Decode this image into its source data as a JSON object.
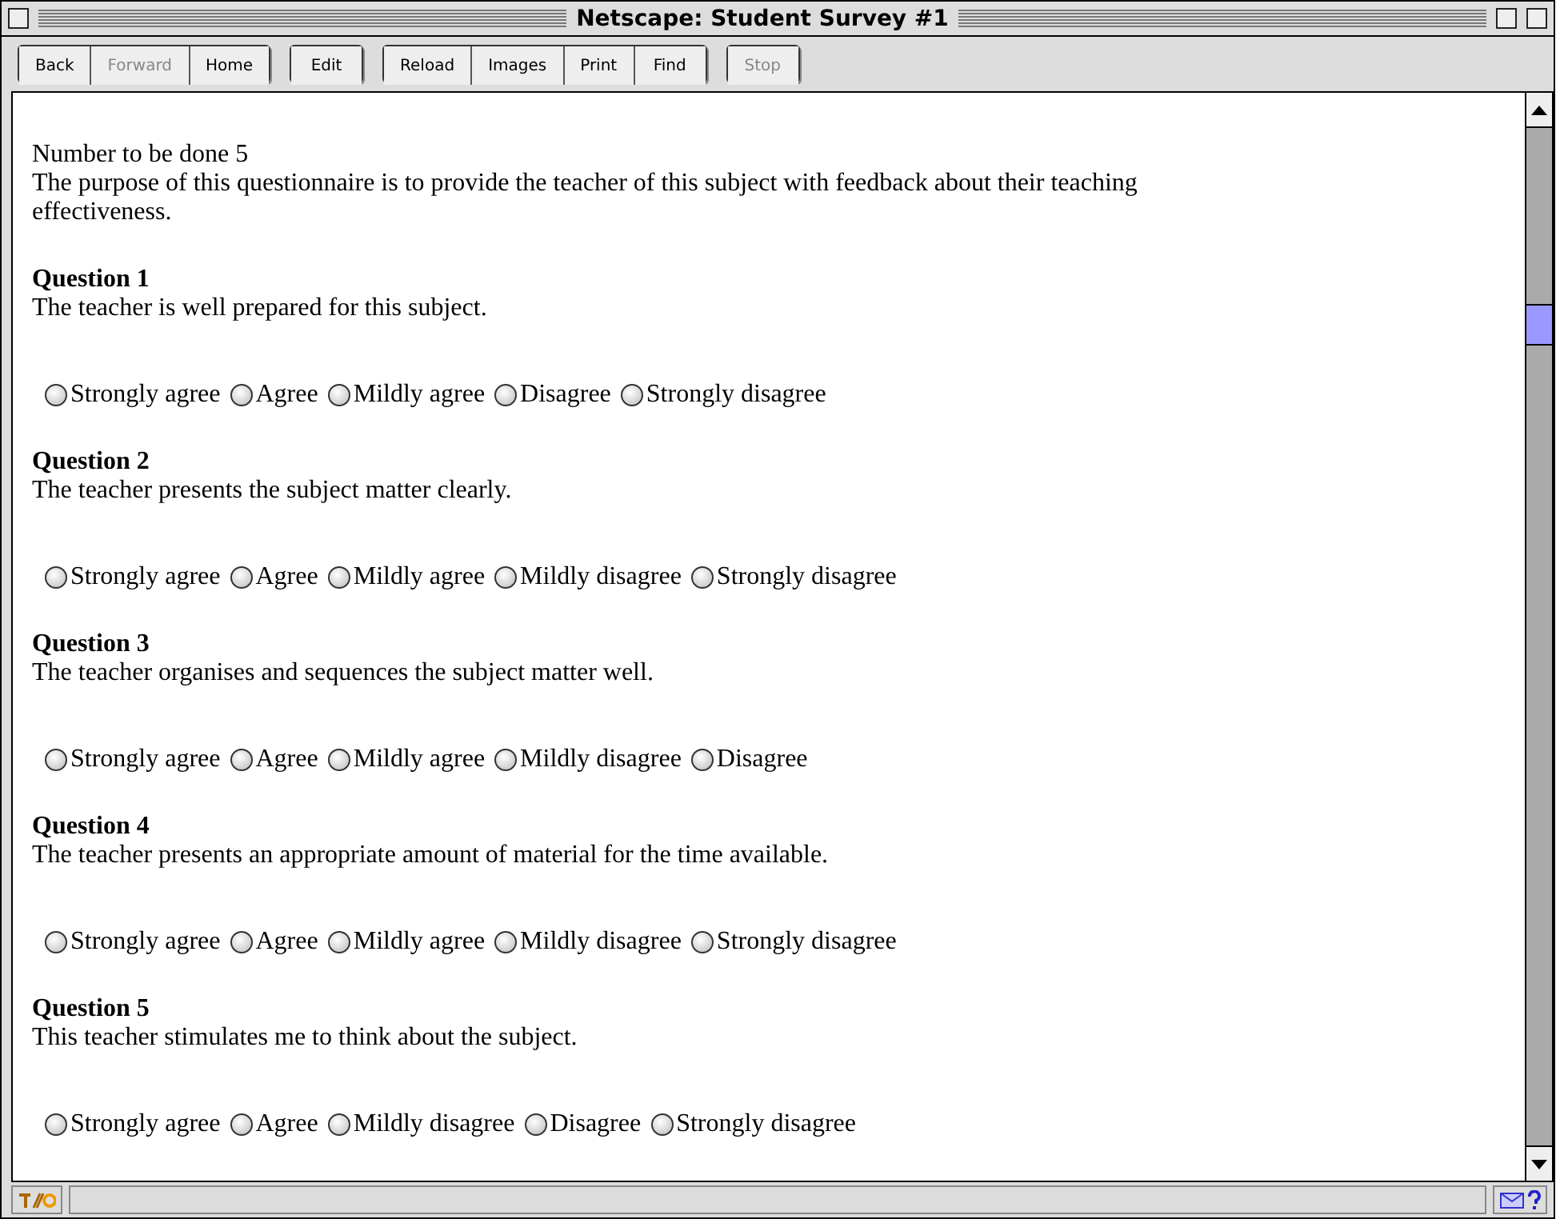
{
  "window": {
    "title": "Netscape: Student Survey #1"
  },
  "toolbar": [
    [
      {
        "label": "Back",
        "disabled": false
      },
      {
        "label": "Forward",
        "disabled": true
      },
      {
        "label": "Home",
        "disabled": false
      }
    ],
    [
      {
        "label": "Edit",
        "disabled": false
      }
    ],
    [
      {
        "label": "Reload",
        "disabled": false
      },
      {
        "label": "Images",
        "disabled": false
      },
      {
        "label": "Print",
        "disabled": false
      },
      {
        "label": "Find",
        "disabled": false
      }
    ],
    [
      {
        "label": "Stop",
        "disabled": true
      }
    ]
  ],
  "intro": [
    "Number to be done 5",
    "The purpose of this questionnaire is to provide the teacher of this subject with feedback about their teaching effectiveness."
  ],
  "questions": [
    {
      "title": "Question 1",
      "text": "The teacher is well prepared for this subject.",
      "options": [
        {
          "label": "Strongly agree",
          "selected": false
        },
        {
          "label": "Agree",
          "selected": false
        },
        {
          "label": "Mildly agree",
          "selected": false
        },
        {
          "label": "Disagree",
          "selected": false
        },
        {
          "label": "Strongly disagree",
          "selected": false
        }
      ]
    },
    {
      "title": "Question 2",
      "text": "The teacher presents the subject matter clearly.",
      "options": [
        {
          "label": "Strongly agree",
          "selected": false
        },
        {
          "label": "Agree",
          "selected": false
        },
        {
          "label": "Mildly agree",
          "selected": false
        },
        {
          "label": "Mildly disagree",
          "selected": false
        },
        {
          "label": "Strongly disagree",
          "selected": false
        }
      ]
    },
    {
      "title": "Question 3",
      "text": "The teacher organises and sequences the subject matter well.",
      "options": [
        {
          "label": "Strongly agree",
          "selected": false
        },
        {
          "label": "Agree",
          "selected": false
        },
        {
          "label": "Mildly agree",
          "selected": false
        },
        {
          "label": "Mildly disagree",
          "selected": false
        },
        {
          "label": "Disagree",
          "selected": false
        }
      ]
    },
    {
      "title": "Question 4",
      "text": "The teacher presents an appropriate amount of material for the time available.",
      "options": [
        {
          "label": "Strongly agree",
          "selected": false
        },
        {
          "label": "Agree",
          "selected": false
        },
        {
          "label": "Mildly agree",
          "selected": false
        },
        {
          "label": "Mildly disagree",
          "selected": false
        },
        {
          "label": "Strongly disagree",
          "selected": false
        }
      ]
    },
    {
      "title": "Question 5",
      "text": "This teacher stimulates me to think about the subject.",
      "options": [
        {
          "label": "Strongly agree",
          "selected": false
        },
        {
          "label": "Agree",
          "selected": false
        },
        {
          "label": "Mildly disagree",
          "selected": false
        },
        {
          "label": "Disagree",
          "selected": false
        },
        {
          "label": "Strongly disagree",
          "selected": false
        }
      ]
    }
  ]
}
